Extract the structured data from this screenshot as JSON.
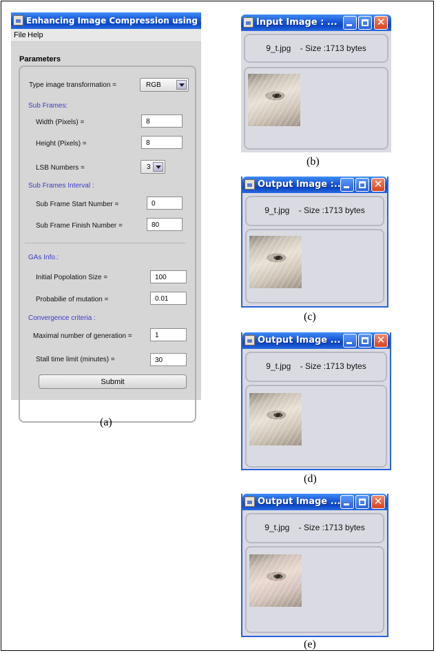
{
  "app": {
    "title": "Enhancing Image Compression using GAs",
    "menu": [
      "File",
      "Help"
    ],
    "parameters_title": "Parameters",
    "transform_label": "Type image transformation =",
    "transform_value": "RGB",
    "subframes_heading": "Sub Frames:",
    "width_label": "Width (Pixels)  =",
    "width_value": "8",
    "height_label": "Height (Pixels) =",
    "height_value": "8",
    "lsb_label": "LSB Numbers  =",
    "lsb_value": "3",
    "interval_heading": "Sub Frames Interval :",
    "start_label": "Sub Frame Start Number =",
    "start_value": "0",
    "finish_label": "Sub Frame Finish Number =",
    "finish_value": "80",
    "gas_heading": "GAs Info.:",
    "pop_label": "Initial Popolation Size =",
    "pop_value": "100",
    "mut_label": "Probabilie of mutation =",
    "mut_value": "0.01",
    "conv_heading": "Convergence criteria :",
    "maxgen_label": "Maximal number of generation =",
    "maxgen_value": "1",
    "stall_label": "Stall time limit (minutes) =",
    "stall_value": "30",
    "submit_label": "Submit"
  },
  "windows": [
    {
      "title": "Input Image : ...",
      "info": "9_t.jpg    - Size :1713 bytes",
      "caption": "(b)"
    },
    {
      "title": "Output Image :...",
      "info": "9_t.jpg    - Size :1713 bytes",
      "caption": "(c)"
    },
    {
      "title": "Output Image ...",
      "info": "9_t.jpg    - Size :1713 bytes",
      "caption": "(d)"
    },
    {
      "title": "Output Image ...",
      "info": "9_t.jpg    - Size :1713 bytes",
      "caption": "(e)"
    }
  ],
  "caption_a": "(a)",
  "icons": [
    "java-app-icon",
    "minimize-icon",
    "maximize-icon",
    "close-icon",
    "dropdown-arrow-icon"
  ]
}
